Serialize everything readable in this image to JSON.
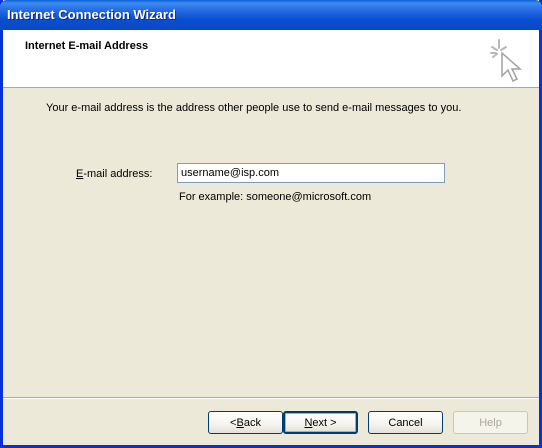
{
  "window": {
    "title": "Internet Connection Wizard"
  },
  "header": {
    "title": "Internet E-mail Address",
    "icon": "wizard-cursor-icon"
  },
  "main": {
    "intro": "Your e-mail address is the address other people use to send e-mail messages to you.",
    "email_label_accel": "E",
    "email_label_rest": "-mail address:",
    "email_value": "username@isp.com",
    "example": "For example: someone@microsoft.com"
  },
  "buttons": {
    "back_prefix": "< ",
    "back_accel": "B",
    "back_rest": "ack",
    "next_accel": "N",
    "next_rest": "ext >",
    "cancel": "Cancel",
    "help": "Help"
  },
  "colors": {
    "titlebar": "#0a4fd0",
    "background": "#ece9d8",
    "border": "#0831d9"
  }
}
